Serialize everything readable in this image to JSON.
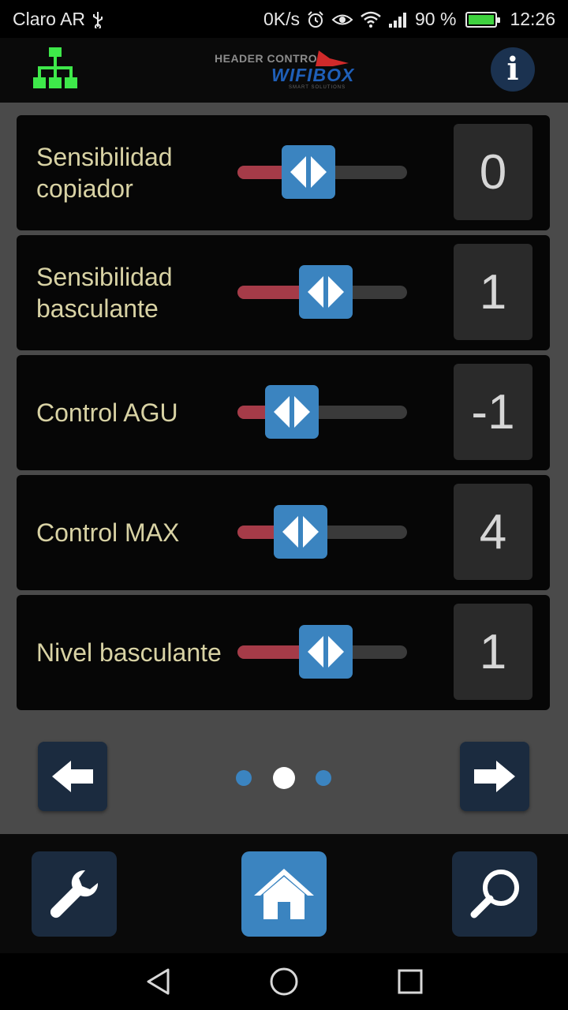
{
  "status_bar": {
    "carrier": "Claro AR",
    "net_speed": "0K/s",
    "battery_percent": "90 %",
    "time": "12:26"
  },
  "header": {
    "logo_top": "HEADER CONTROL",
    "logo_brand": "WIFIBOX",
    "logo_tag": "SMART SOLUTIONS",
    "info_label": "i"
  },
  "sliders": [
    {
      "label": "Sensibilidad copiador",
      "value": "0",
      "level": 0.42
    },
    {
      "label": "Sensibilidad basculante",
      "value": "1",
      "level": 0.52
    },
    {
      "label": "Control AGU",
      "value": "-1",
      "level": 0.32
    },
    {
      "label": "Control MAX",
      "value": "4",
      "level": 0.37
    },
    {
      "label": "Nivel basculante",
      "value": "1",
      "level": 0.52
    }
  ],
  "pager": {
    "pages": 3,
    "current": 2
  },
  "colors": {
    "accent": "#3b84c0",
    "slider_fill": "#a53b48",
    "label_text": "#d8d2a4",
    "network_icon": "#3ee84a"
  },
  "icons": {
    "network": "network-tree-icon",
    "info": "info-icon",
    "prev": "arrow-left-icon",
    "next": "arrow-right-icon",
    "settings": "wrench-icon",
    "home": "home-icon",
    "search": "search-icon"
  }
}
